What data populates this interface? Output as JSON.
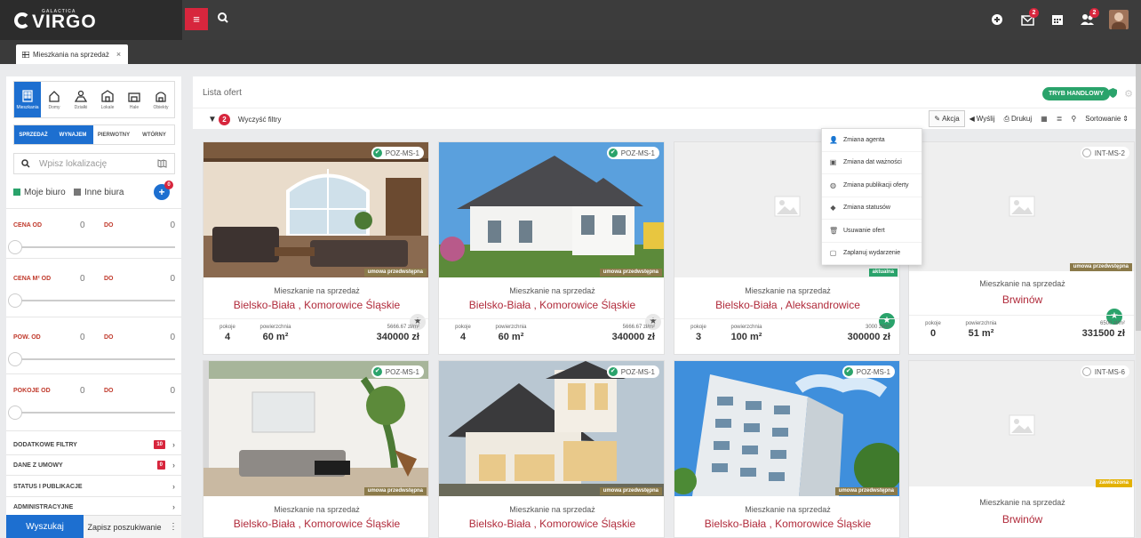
{
  "brand": {
    "small": "GALACTICA",
    "name": "VIRGO"
  },
  "topbar": {
    "menu_label": "≡",
    "badges": {
      "mail": "2",
      "users": "2"
    }
  },
  "tab": {
    "label": "Mieszkania na sprzedaż",
    "close": "×"
  },
  "sidebar": {
    "property_types": [
      {
        "label": "Mieszkania",
        "icon": "apartment-icon",
        "active": true
      },
      {
        "label": "Domy",
        "icon": "house-icon",
        "active": false
      },
      {
        "label": "Działki",
        "icon": "land-icon",
        "active": false
      },
      {
        "label": "Lokale",
        "icon": "commercial-icon",
        "active": false
      },
      {
        "label": "Hale",
        "icon": "hall-icon",
        "active": false
      },
      {
        "label": "Obiekty",
        "icon": "building-icon",
        "active": false
      }
    ],
    "modes": [
      "SPRZEDAŻ",
      "WYNAJEM",
      "PIERWOTNY",
      "WTÓRNY"
    ],
    "location_placeholder": "Wpisz lokalizację",
    "office_mine": "Moje biuro",
    "office_other": "Inne biura",
    "plus_badge": "0",
    "ranges": [
      {
        "label": "CENA OD",
        "from": "0",
        "to_label": "DO",
        "to": "0"
      },
      {
        "label": "CENA M² OD",
        "from": "0",
        "to_label": "DO",
        "to": "0"
      },
      {
        "label": "POW. OD",
        "from": "0",
        "to_label": "DO",
        "to": "0"
      },
      {
        "label": "POKOJE OD",
        "from": "0",
        "to_label": "DO",
        "to": "0"
      }
    ],
    "sections": [
      {
        "label": "DODATKOWE FILTRY",
        "badge": "10"
      },
      {
        "label": "DANE Z UMOWY",
        "badge": "0"
      },
      {
        "label": "STATUS I PUBLIKACJE",
        "badge": ""
      },
      {
        "label": "ADMINISTRACYJNE",
        "badge": ""
      }
    ],
    "search_button": "Wyszukaj",
    "save_search": "Zapisz poszukiwanie",
    "more": "⋮"
  },
  "main": {
    "title": "Lista ofert",
    "trading_mode": "TRYB HANDLOWY",
    "filter_count": "2",
    "clear_filters": "Wyczyść filtry",
    "toolbar": {
      "action": "Akcja",
      "send": "Wyślij",
      "print": "Drukuj",
      "sort": "Sortowanie"
    },
    "action_menu": [
      {
        "label": "Zmiana agenta",
        "icon": "user-icon"
      },
      {
        "label": "Zmiana dat ważności",
        "icon": "calendar-icon"
      },
      {
        "label": "Zmiana publikacji oferty",
        "icon": "globe-icon"
      },
      {
        "label": "Zmiana statusów",
        "icon": "tag-icon"
      },
      {
        "label": "Usuwanie ofert",
        "icon": "trash-icon"
      },
      {
        "label": "Zaplanuj wydarzenie",
        "icon": "calendar-plus-icon"
      }
    ],
    "stats_labels": {
      "rooms": "pokoje",
      "area": "powierzchnia"
    },
    "cards": [
      {
        "code": "POZ-MS-1",
        "status": "umowa przedwstępna",
        "category": "Mieszkanie na sprzedaż",
        "city": "Bielsko-Biała , Komorowice Śląskie",
        "rooms": "4",
        "area": "60 m²",
        "ppm": "5666.67 zł/m²",
        "price": "340000 zł"
      },
      {
        "code": "POZ-MS-1",
        "status": "umowa przedwstępna",
        "category": "Mieszkanie na sprzedaż",
        "city": "Bielsko-Biała , Komorowice Śląskie",
        "rooms": "4",
        "area": "60 m²",
        "ppm": "5666.67 zł/m²",
        "price": "340000 zł"
      },
      {
        "code": "",
        "status": "aktualna",
        "category": "Mieszkanie na sprzedaż",
        "city": "Bielsko-Biała , Aleksandrowice",
        "rooms": "3",
        "area": "100 m²",
        "ppm": "3000 zł/m²",
        "price": "300000 zł"
      },
      {
        "code": "INT-MS-2",
        "status": "umowa przedwstępna",
        "category": "Mieszkanie na sprzedaż",
        "city": "Brwinów",
        "rooms": "0",
        "area": "51 m²",
        "ppm": "6500 zł/m²",
        "price": "331500 zł"
      },
      {
        "code": "POZ-MS-1",
        "status": "umowa przedwstępna",
        "category": "Mieszkanie na sprzedaż",
        "city": "Bielsko-Biała , Komorowice Śląskie"
      },
      {
        "code": "POZ-MS-1",
        "status": "umowa przedwstępna",
        "category": "Mieszkanie na sprzedaż",
        "city": "Bielsko-Biała , Komorowice Śląskie"
      },
      {
        "code": "POZ-MS-1",
        "status": "umowa przedwstępna",
        "category": "Mieszkanie na sprzedaż",
        "city": "Bielsko-Biała , Komorowice Śląskie"
      },
      {
        "code": "INT-MS-6",
        "status": "zawieszona",
        "category": "Mieszkanie na sprzedaż",
        "city": "Brwinów"
      }
    ]
  },
  "colors": {
    "accent": "#1d6fd0",
    "brand_red": "#d7263d",
    "success": "#2aa36b",
    "price_red": "#b02a3a"
  }
}
